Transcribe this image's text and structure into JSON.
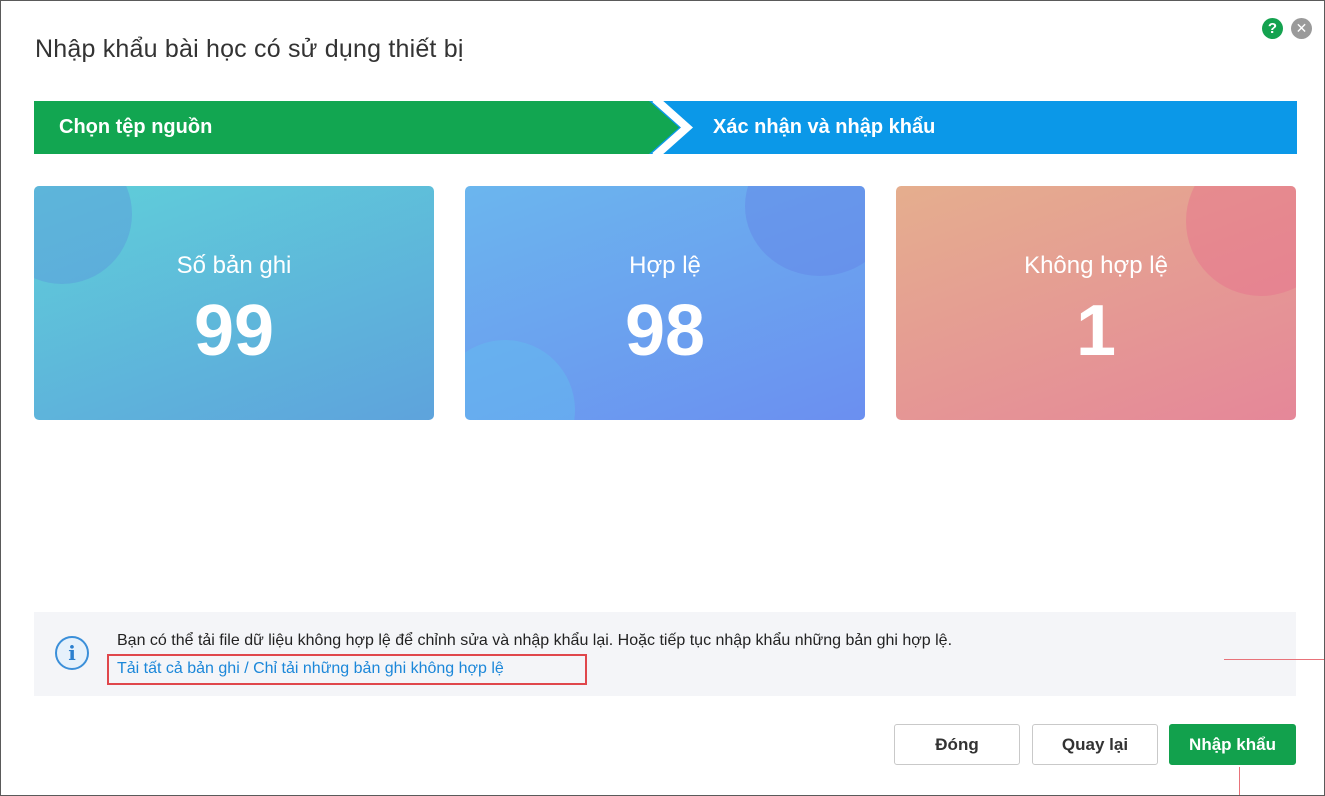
{
  "dialog": {
    "title": "Nhập khẩu bài học có sử dụng thiết bị",
    "help_icon": "help-icon",
    "close_icon": "close-icon",
    "help_glyph": "?",
    "close_glyph": "✕"
  },
  "stepper": {
    "steps": [
      {
        "label": "Chọn tệp nguồn",
        "color": "#12a651"
      },
      {
        "label": "Xác nhận và nhập khẩu",
        "color": "#0b98e8"
      }
    ]
  },
  "cards": [
    {
      "label": "Số bản ghi",
      "value": "99"
    },
    {
      "label": "Hợp lệ",
      "value": "98"
    },
    {
      "label": "Không hợp lệ",
      "value": "1"
    }
  ],
  "info": {
    "icon": "info-icon",
    "glyph": "i",
    "message": "Bạn có thể tải file dữ liệu không hợp lệ để chỉnh sửa và nhập khẩu lại. Hoặc tiếp tục nhập khẩu những bản ghi hợp lệ.",
    "link_all": "Tải tất cả bản ghi",
    "separator": " / ",
    "link_invalid": "Chỉ tải những bản ghi không hợp lệ"
  },
  "buttons": {
    "close": "Đóng",
    "back": "Quay lại",
    "import": "Nhập khẩu",
    "primary_color": "#12a14d"
  }
}
